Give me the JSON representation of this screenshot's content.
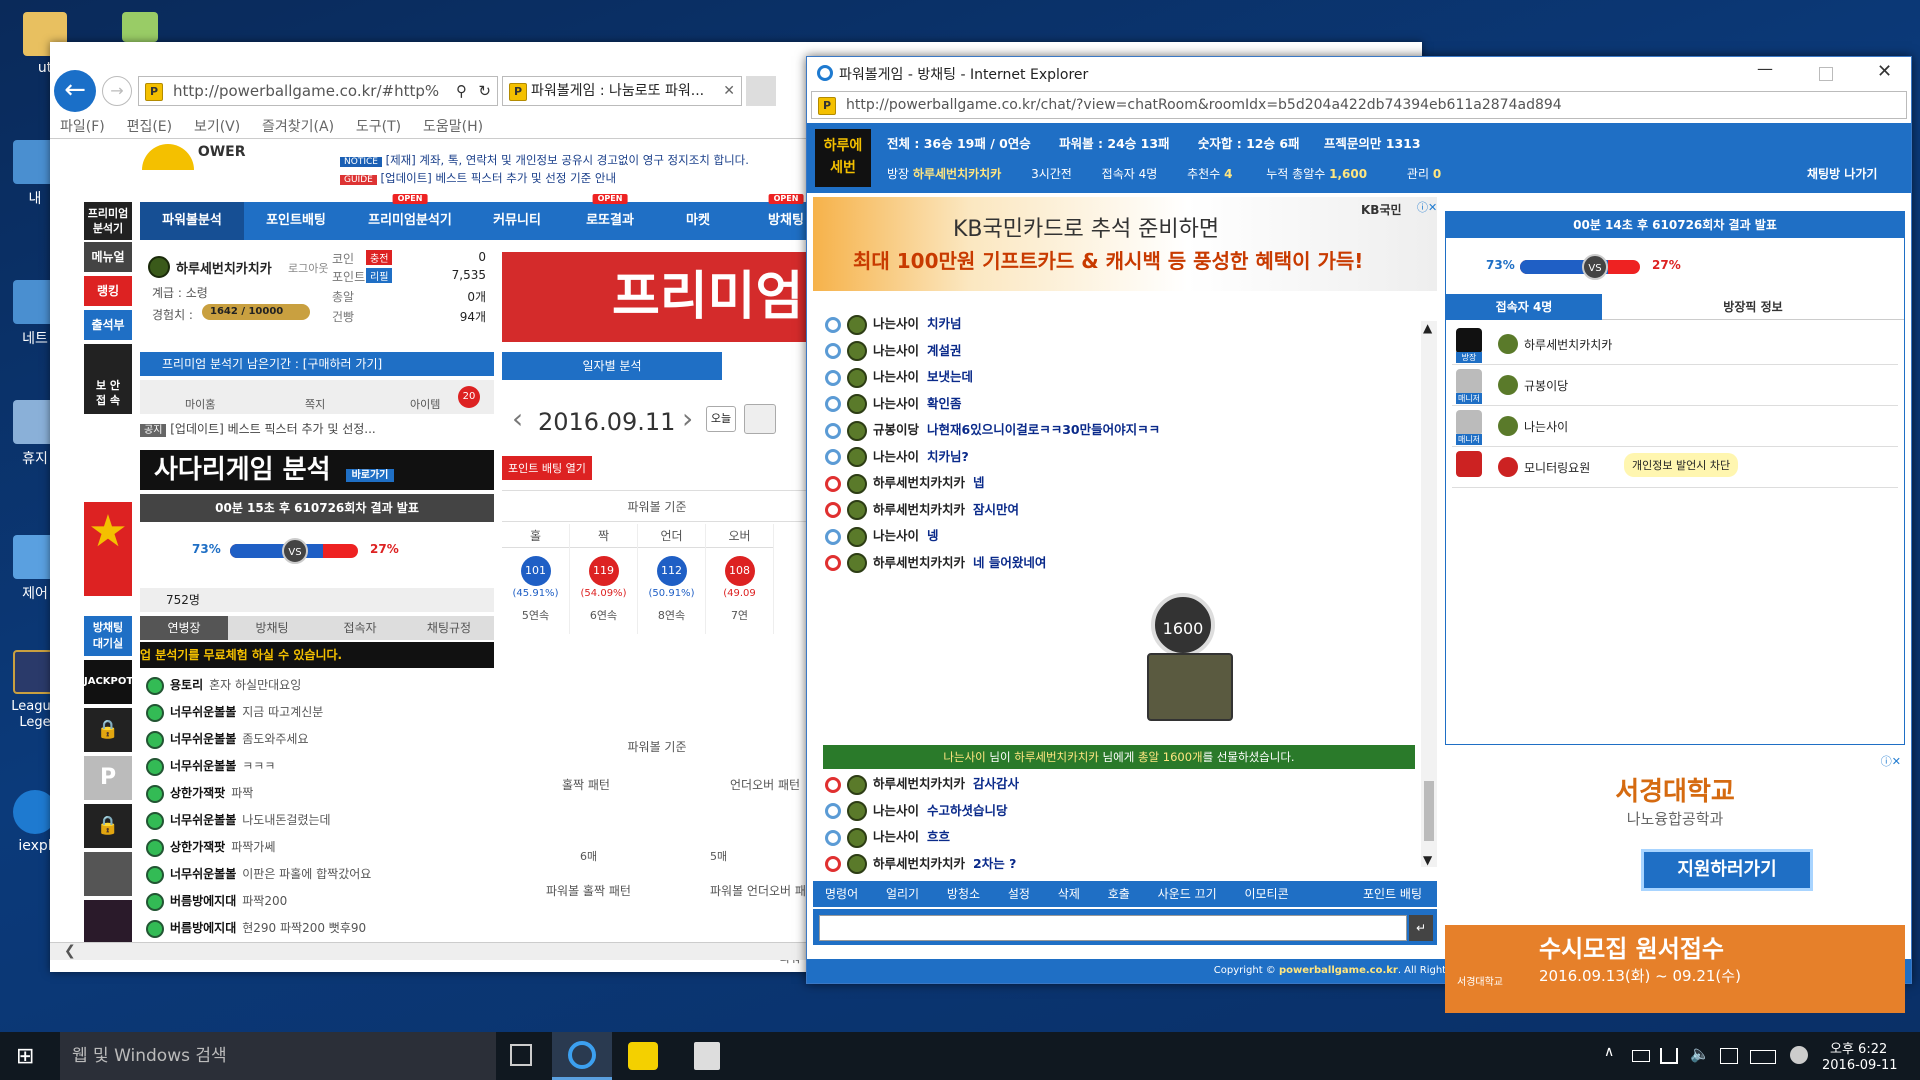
{
  "desktop": {
    "icons": [
      "ut",
      "내 ",
      "네트",
      "휴지",
      "제어",
      "League\nLege",
      "iexpl"
    ]
  },
  "ie_main": {
    "url": "http://powerballgame.co.kr/#http%",
    "tab_title": "파워볼게임 : 나눔로또 파워...",
    "menu": [
      "파일(F)",
      "편집(E)",
      "보기(V)",
      "즐겨찾기(A)",
      "도구(T)",
      "도움말(H)"
    ],
    "logo": "OWER",
    "notice_tag": "NOTICE",
    "notice_text": "[제재] 계좌, 톡, 연락처 및 개인정보 공유시 경고없이 영구 정지조치 합니다.",
    "guide_tag": "GUIDE",
    "guide_text": "[업데이트] 베스트 픽스터 추가 및 선정 기준 안내",
    "nav": [
      "파워볼분석",
      "포인트배팅",
      "프리미엄분석기",
      "커뮤니티",
      "로또결과",
      "마켓",
      "방채팅"
    ],
    "open_badge": "OPEN",
    "side": [
      "프리미엄\n분석기",
      "메뉴얼",
      "랭킹",
      "출석부",
      "보 안\n접 속",
      "방채팅\n대기실"
    ],
    "profile": {
      "name": "하루세번치카치카",
      "logout": "로그아웃",
      "grade": "계급 : 소령",
      "exp_label": "경험치 :",
      "exp": "1642 / 10000",
      "coin_label": "코인",
      "coin_btn": "충전",
      "coin": "0",
      "point_label": "포인트",
      "point_btn": "리필",
      "point": "7,535",
      "bomb_label": "총알",
      "bomb": "0개",
      "gun_label": "건빵",
      "gun": "94개"
    },
    "premium_bar": "프리미엄 분석기 남은기간 : [구매하러 가기]",
    "quick": [
      "마이홈",
      "쪽지",
      "아이템"
    ],
    "item_count": "20",
    "notice_small_tag": "공지",
    "notice_small": "[업데이트] 베스트 픽스터 추가 및 선정...",
    "ladder_banner": "사다리게임 분석",
    "ladder_go": "바로가기",
    "result_title": "00분 15초 후 610726회차 결과 발표",
    "odd_pct": "73%",
    "even_pct": "27%",
    "odd_fill": 0.73,
    "vs": "VS",
    "chat_count": "752명",
    "chat_tabs": [
      "연병장",
      "방채팅",
      "접속자",
      "채팅규정"
    ],
    "marquee": "업 분석기를 무료체험 하실 수 있습니다.",
    "chat": [
      {
        "n": "용토리",
        "m": "혼자 하실만대요잉"
      },
      {
        "n": "너무쉬운볼볼",
        "m": "지금 따고계신분"
      },
      {
        "n": "너무쉬운볼볼",
        "m": "좀도와주세요"
      },
      {
        "n": "너무쉬운볼볼",
        "m": "ㅋㅋㅋ"
      },
      {
        "n": "상한가잭팟",
        "m": "파짝"
      },
      {
        "n": "너무쉬운볼볼",
        "m": "나도내돈걸렸는데"
      },
      {
        "n": "상한가잭팟",
        "m": "파짝가쎄"
      },
      {
        "n": "너무쉬운볼볼",
        "m": "이판은 파홀에 합짝갔어요"
      },
      {
        "n": "버름방에지대",
        "m": "파짝200"
      },
      {
        "n": "버름방에지대",
        "m": "현290 파짝200 뻣후90"
      }
    ],
    "premium_banner": "프리미엄",
    "daily_tab": "일자별 분석",
    "date": "2016.09.11",
    "today": "오늘",
    "point_bet": "포인트 배팅 열기",
    "pb_header": "파워볼 기준",
    "cols": [
      "홀",
      "짝",
      "언더",
      "오버"
    ],
    "vals": [
      "101",
      "119",
      "112",
      "108"
    ],
    "pcts": [
      "(45.91%)",
      "(54.09%)",
      "(50.91%)",
      "(49.09"
    ],
    "streak": [
      "5연속",
      "6연속",
      "8연속",
      "7연"
    ],
    "pb_header2": "파워볼 기준",
    "pattern": [
      "홀짝 패턴",
      "언더오버 패턴"
    ],
    "pattern_vals": [
      "6매",
      "5매"
    ],
    "pattern2": [
      "파워볼 홀짝 패턴",
      "파워볼 언더오버 패"
    ],
    "bottom_label": "파워"
  },
  "ie_chat": {
    "title": "파워볼게임 - 방채팅 - Internet Explorer",
    "url": "http://powerballgame.co.kr/chat/?view=chatRoom&roomIdx=b5d204a422db74394eb611a2874ad894",
    "logo_text": "하루에\n세번",
    "stats": [
      "전체 : 36승 19패 / 0연승",
      "파워볼 : 24승 13패",
      "숫자합 : 12승 6패",
      "프젝문의만 1313"
    ],
    "room_owner_label": "방장",
    "room_owner": "하루세번치카치카",
    "time": "3시간전",
    "users": "접속자 4명",
    "recommend_label": "추천수",
    "recommend": "4",
    "bullet_label": "누적 총알수",
    "bullet": "1,600",
    "manage_label": "관리",
    "manage": "0",
    "leave": "채팅방 나가기",
    "ad_line1": "KB국민카드로 추석 준비하면",
    "ad_line2": "최대 100만원 기프트카드 & 캐시백 등 풍성한 혜택이 가득!",
    "ad_brand": "KB국민",
    "messages": [
      {
        "c": "blue",
        "n": "나는사이",
        "m": "치카넘"
      },
      {
        "c": "blue",
        "n": "나는사이",
        "m": "계설권"
      },
      {
        "c": "blue",
        "n": "나는사이",
        "m": "보냇는데"
      },
      {
        "c": "blue",
        "n": "나는사이",
        "m": "확인좀"
      },
      {
        "c": "blue",
        "n": "규봉이당",
        "m": "나현재6있으니이걸로ㅋㅋ30만들어야지ㅋㅋ"
      },
      {
        "c": "blue",
        "n": "나는사이",
        "m": "치카님?"
      },
      {
        "c": "red",
        "n": "하루세번치카치카",
        "m": "넵"
      },
      {
        "c": "red",
        "n": "하루세번치카치카",
        "m": "잠시만여"
      },
      {
        "c": "blue",
        "n": "나는사이",
        "m": "넹"
      },
      {
        "c": "red",
        "n": "하루세번치카치카",
        "m": "네 들어왔네여"
      }
    ],
    "gift_count": "1600",
    "gift_msg_pre": "나는사이",
    "gift_msg_mid1": " 님이 ",
    "gift_msg_to": "하루세번치카치카",
    "gift_msg_mid2": " 님에게 ",
    "gift_msg_amt": "총알 1600개",
    "gift_msg_post": "를 선물하셨습니다.",
    "messages2": [
      {
        "c": "red",
        "n": "하루세번치카치카",
        "m": "감사감사"
      },
      {
        "c": "blue",
        "n": "나는사이",
        "m": "수고하셧습니당"
      },
      {
        "c": "blue",
        "n": "나는사이",
        "m": "흐흐"
      },
      {
        "c": "red",
        "n": "하루세번치카치카",
        "m": "2차는 ?"
      }
    ],
    "tools": [
      "명령어",
      "얼리기",
      "방청소",
      "설정",
      "삭제",
      "호출",
      "사운드 끄기",
      "이모티콘"
    ],
    "point_bet": "포인트 배팅",
    "footer_pre": "Copyright © ",
    "footer_site": "powerballgame.co.kr",
    "footer_post": ". All Rights Reserved.",
    "result_title": "00분 14초 후 610726회차 결과 발표",
    "odd_pct": "73%",
    "even_pct": "27%",
    "odd_fill": 0.73,
    "vs": "VS",
    "tabs": [
      "접속자 4명",
      "방장픽 정보"
    ],
    "user_list": [
      {
        "role": "방장",
        "name": "하루세번치카치카"
      },
      {
        "role": "매니저",
        "name": "규봉이당"
      },
      {
        "role": "매니저",
        "name": "나는사이"
      },
      {
        "role": "",
        "name": "모니터링요원",
        "tag": "개인정보 발언시 차단"
      }
    ],
    "ad2_title": "서경대학교",
    "ad2_sub": "나노융합공학과",
    "ad2_btn": "지원하러가기",
    "ad3_title": "수시모집 원서접수",
    "ad3_date": "2016.09.13(화) ~ 09.21(수)",
    "ad3_logo": "서경대학교"
  },
  "taskbar": {
    "search": "웹 및 Windows 검색",
    "time": "오후 6:22",
    "date": "2016-09-11"
  }
}
